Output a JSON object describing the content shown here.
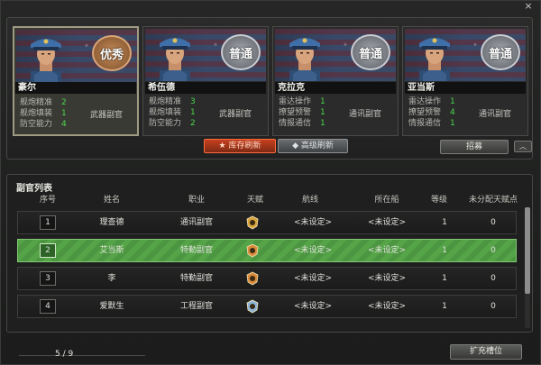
{
  "candidates": [
    {
      "name": "豪尔",
      "rank": "优秀",
      "rank_type": "excellent",
      "stats": [
        {
          "name": "舰炮精准",
          "value": "2"
        },
        {
          "name": "舰炮填装",
          "value": "1"
        },
        {
          "name": "防空能力",
          "value": "4"
        }
      ],
      "role": "武器副官"
    },
    {
      "name": "希伍德",
      "rank": "普通",
      "rank_type": "normal",
      "stats": [
        {
          "name": "舰炮精准",
          "value": "3"
        },
        {
          "name": "舰炮填装",
          "value": "1"
        },
        {
          "name": "防空能力",
          "value": "2"
        }
      ],
      "role": "武器副官"
    },
    {
      "name": "克拉克",
      "rank": "普通",
      "rank_type": "normal",
      "stats": [
        {
          "name": "雷达操作",
          "value": "1"
        },
        {
          "name": "撩望预警",
          "value": "1"
        },
        {
          "name": "情报通信",
          "value": "1"
        }
      ],
      "role": "通讯副官"
    },
    {
      "name": "亚当斯",
      "rank": "普通",
      "rank_type": "normal",
      "stats": [
        {
          "name": "雷达操作",
          "value": "1"
        },
        {
          "name": "撩望预警",
          "value": "4"
        },
        {
          "name": "情报通信",
          "value": "1"
        }
      ],
      "role": "通讯副官"
    }
  ],
  "buttons": {
    "refresh_red": "★ 库存刷新",
    "refresh_gray": "◆ 高级刷新",
    "recruit": "招募",
    "collapse": "︿",
    "expand_slots": "扩充槽位",
    "close": "×"
  },
  "list": {
    "title": "副官列表",
    "headers": {
      "index": "序号",
      "name": "姓名",
      "job": "职业",
      "talent": "天赋",
      "route": "航线",
      "ship": "所在船",
      "level": "等级",
      "points": "未分配天赋点"
    },
    "rows": [
      {
        "index": "1",
        "name": "理查德",
        "job": "通讯副官",
        "route": "<未设定>",
        "ship": "<未设定>",
        "level": "1",
        "points": "0",
        "talent_color": "#d7a53d"
      },
      {
        "index": "2",
        "name": "艾当斯",
        "job": "特勤副官",
        "route": "<未设定>",
        "ship": "<未设定>",
        "level": "1",
        "points": "0",
        "talent_color": "#d98a3a"
      },
      {
        "index": "3",
        "name": "李",
        "job": "特勤副官",
        "route": "<未设定>",
        "ship": "<未设定>",
        "level": "1",
        "points": "0",
        "talent_color": "#d98a3a"
      },
      {
        "index": "4",
        "name": "爱默生",
        "job": "工程副官",
        "route": "<未设定>",
        "ship": "<未设定>",
        "level": "1",
        "points": "0",
        "talent_color": "#8fb6d9"
      }
    ]
  },
  "pagination": {
    "text": "5 / 9"
  }
}
